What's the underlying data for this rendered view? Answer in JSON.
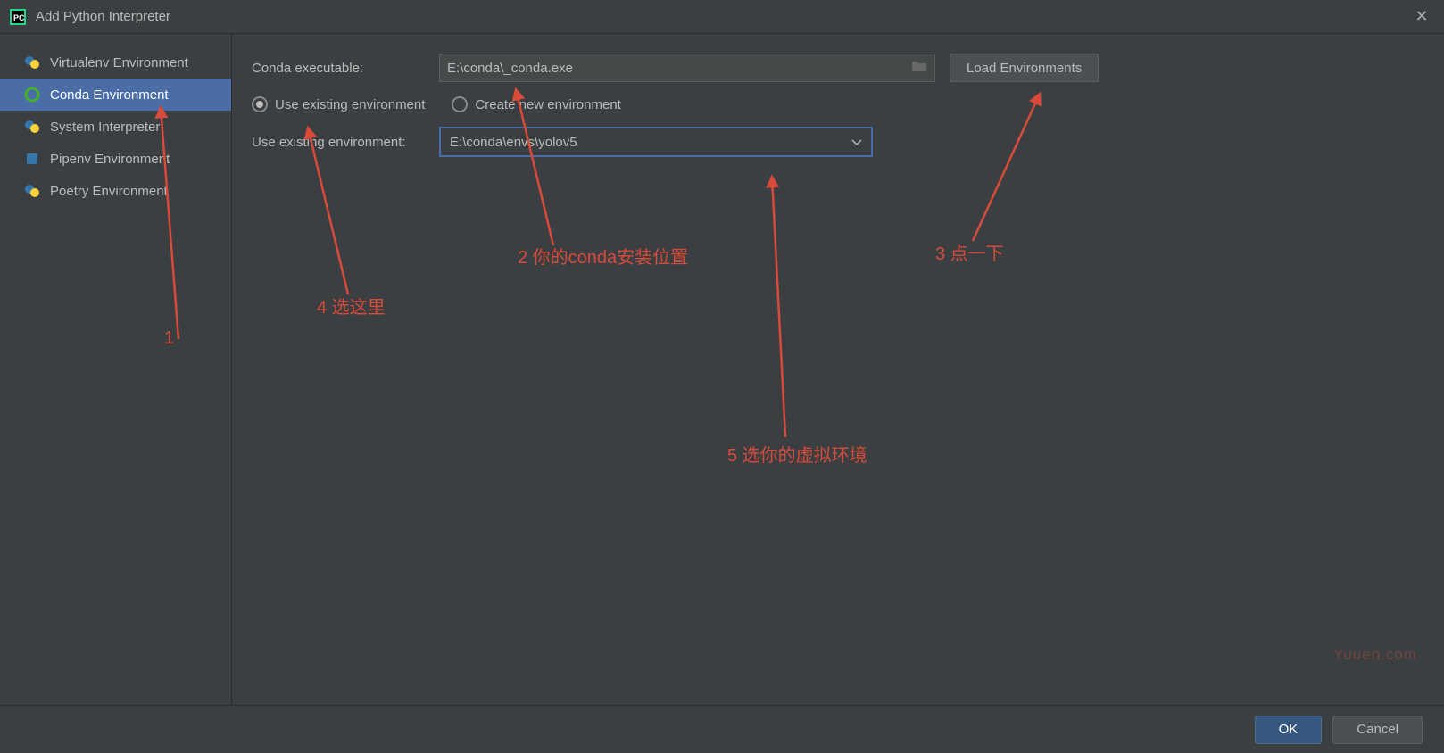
{
  "title": "Add Python Interpreter",
  "sidebar": {
    "items": [
      {
        "label": "Virtualenv Environment",
        "icon": "python"
      },
      {
        "label": "Conda Environment",
        "icon": "conda"
      },
      {
        "label": "System Interpreter",
        "icon": "python"
      },
      {
        "label": "Pipenv Environment",
        "icon": "pipenv"
      },
      {
        "label": "Poetry Environment",
        "icon": "python"
      }
    ],
    "selected_index": 1
  },
  "form": {
    "conda_exe_label": "Conda executable:",
    "conda_exe_value": "E:\\conda\\_conda.exe",
    "load_btn": "Load Environments",
    "radio_existing": "Use existing environment",
    "radio_create": "Create new environment",
    "radio_selected": "existing",
    "use_existing_label": "Use existing environment:",
    "use_existing_value": "E:\\conda\\envs\\yolov5"
  },
  "buttons": {
    "ok": "OK",
    "cancel": "Cancel"
  },
  "annotations": {
    "a1": "1",
    "a2": "2 你的conda安装位置",
    "a3": "3 点一下",
    "a4": "4 选这里",
    "a5": "5 选你的虚拟环境"
  },
  "watermark": "Yuuen.com"
}
